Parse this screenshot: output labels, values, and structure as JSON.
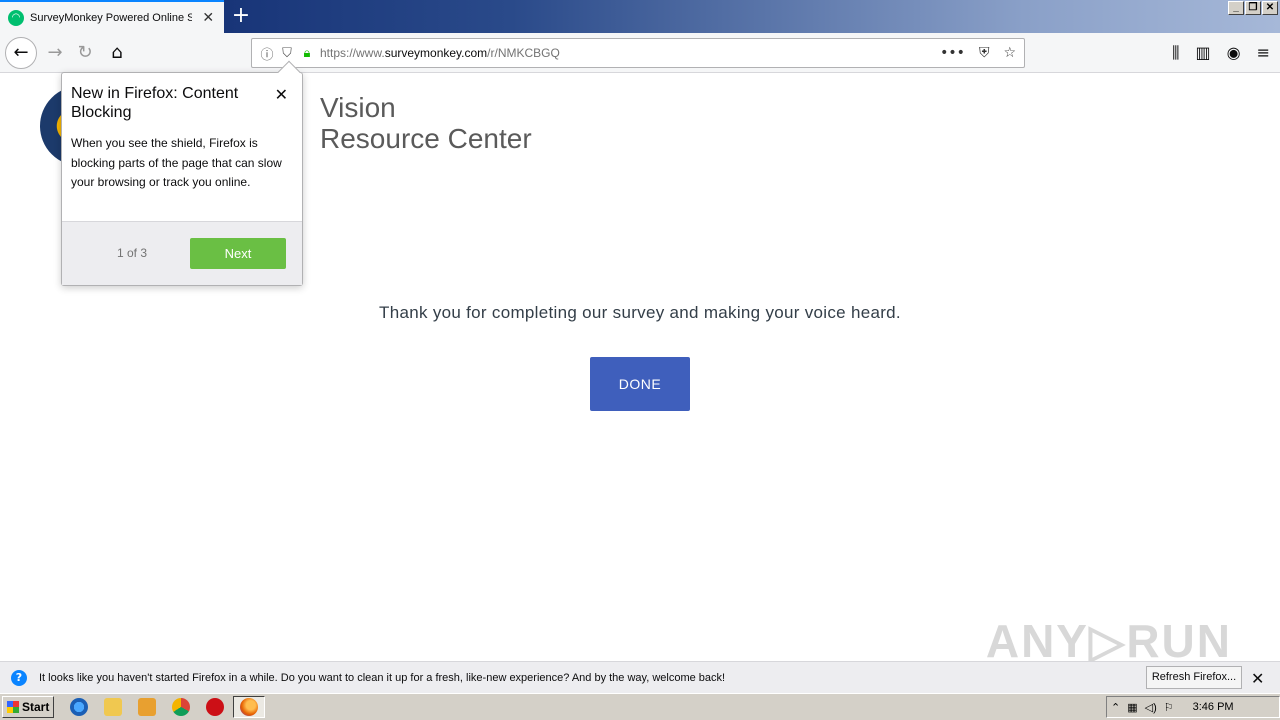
{
  "browser": {
    "tab_title": "SurveyMonkey Powered Online Su",
    "tab_close": "✕",
    "new_tab": "+",
    "window_buttons": [
      "_",
      "❐",
      "✕"
    ],
    "url_scheme": "https://www.",
    "url_host": "surveymonkey.com",
    "url_path": "/r/NMKCBGQ"
  },
  "page": {
    "org_name_line1": "Vision",
    "org_name_line2": "Resource Center",
    "thanks_message": "Thank you for completing our survey and making your voice heard.",
    "done_label": "DONE",
    "watermark": "ANY▷RUN"
  },
  "popup": {
    "title": "New in Firefox: Content Blocking",
    "body": "When you see the shield, Firefox is blocking parts of the page that can slow your browsing or track you online.",
    "step": "1 of 3",
    "next_label": "Next",
    "close": "✕"
  },
  "notification": {
    "text": "It looks like you haven't started Firefox in a while. Do you want to clean it up for a fresh, like-new experience? And by the way, welcome back!",
    "refresh_label": "Refresh Firefox...",
    "close": "✕",
    "icon": "?"
  },
  "taskbar": {
    "start_label": "Start",
    "clock": "3:46 PM"
  },
  "colors": {
    "done_button": "#3f5fbc",
    "next_button": "#6abf44",
    "lock": "#12bc00"
  }
}
